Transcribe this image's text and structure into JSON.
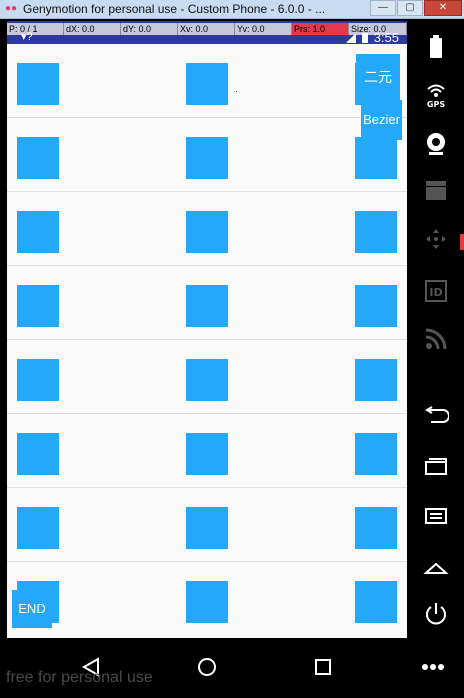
{
  "window": {
    "title": "Genymotion for personal use - Custom Phone - 6.0.0 - ...",
    "app_icon": "genymotion-logo-icon",
    "controls": [
      "minimize-icon",
      "maximize-icon",
      "close-icon"
    ]
  },
  "status_bar": {
    "time": "3:55",
    "pointer_location": [
      {
        "label": "P: 0 / 1"
      },
      {
        "label": "dX: 0.0"
      },
      {
        "label": "dY: 0.0"
      },
      {
        "label": "Xv: 0.0"
      },
      {
        "label": "Yv: 0.0"
      },
      {
        "label": "Prs: 1.0"
      },
      {
        "label": "Size: 0.0"
      }
    ]
  },
  "content": {
    "rows": 8,
    "columns": 3,
    "accent_color": "#24a8f9",
    "buttons": {
      "erju_label": "二元",
      "bezier_label": "Bezier",
      "end_label": "END"
    }
  },
  "toolbar": {
    "items": [
      {
        "name": "battery-icon"
      },
      {
        "name": "gps-icon",
        "label": "GPS"
      },
      {
        "name": "webcam-icon"
      },
      {
        "name": "clapperboard-icon"
      },
      {
        "name": "dpad-icon"
      },
      {
        "name": "id-icon",
        "label": "ID"
      },
      {
        "name": "rss-icon"
      },
      {
        "name": "back-icon"
      },
      {
        "name": "recent-apps-icon"
      },
      {
        "name": "menu-icon"
      },
      {
        "name": "home-icon"
      },
      {
        "name": "power-icon"
      }
    ]
  },
  "navbar": {
    "items": [
      "back-triangle-icon",
      "home-circle-icon",
      "recents-square-icon",
      "more-dots-icon"
    ],
    "watermark": "free for personal use"
  }
}
